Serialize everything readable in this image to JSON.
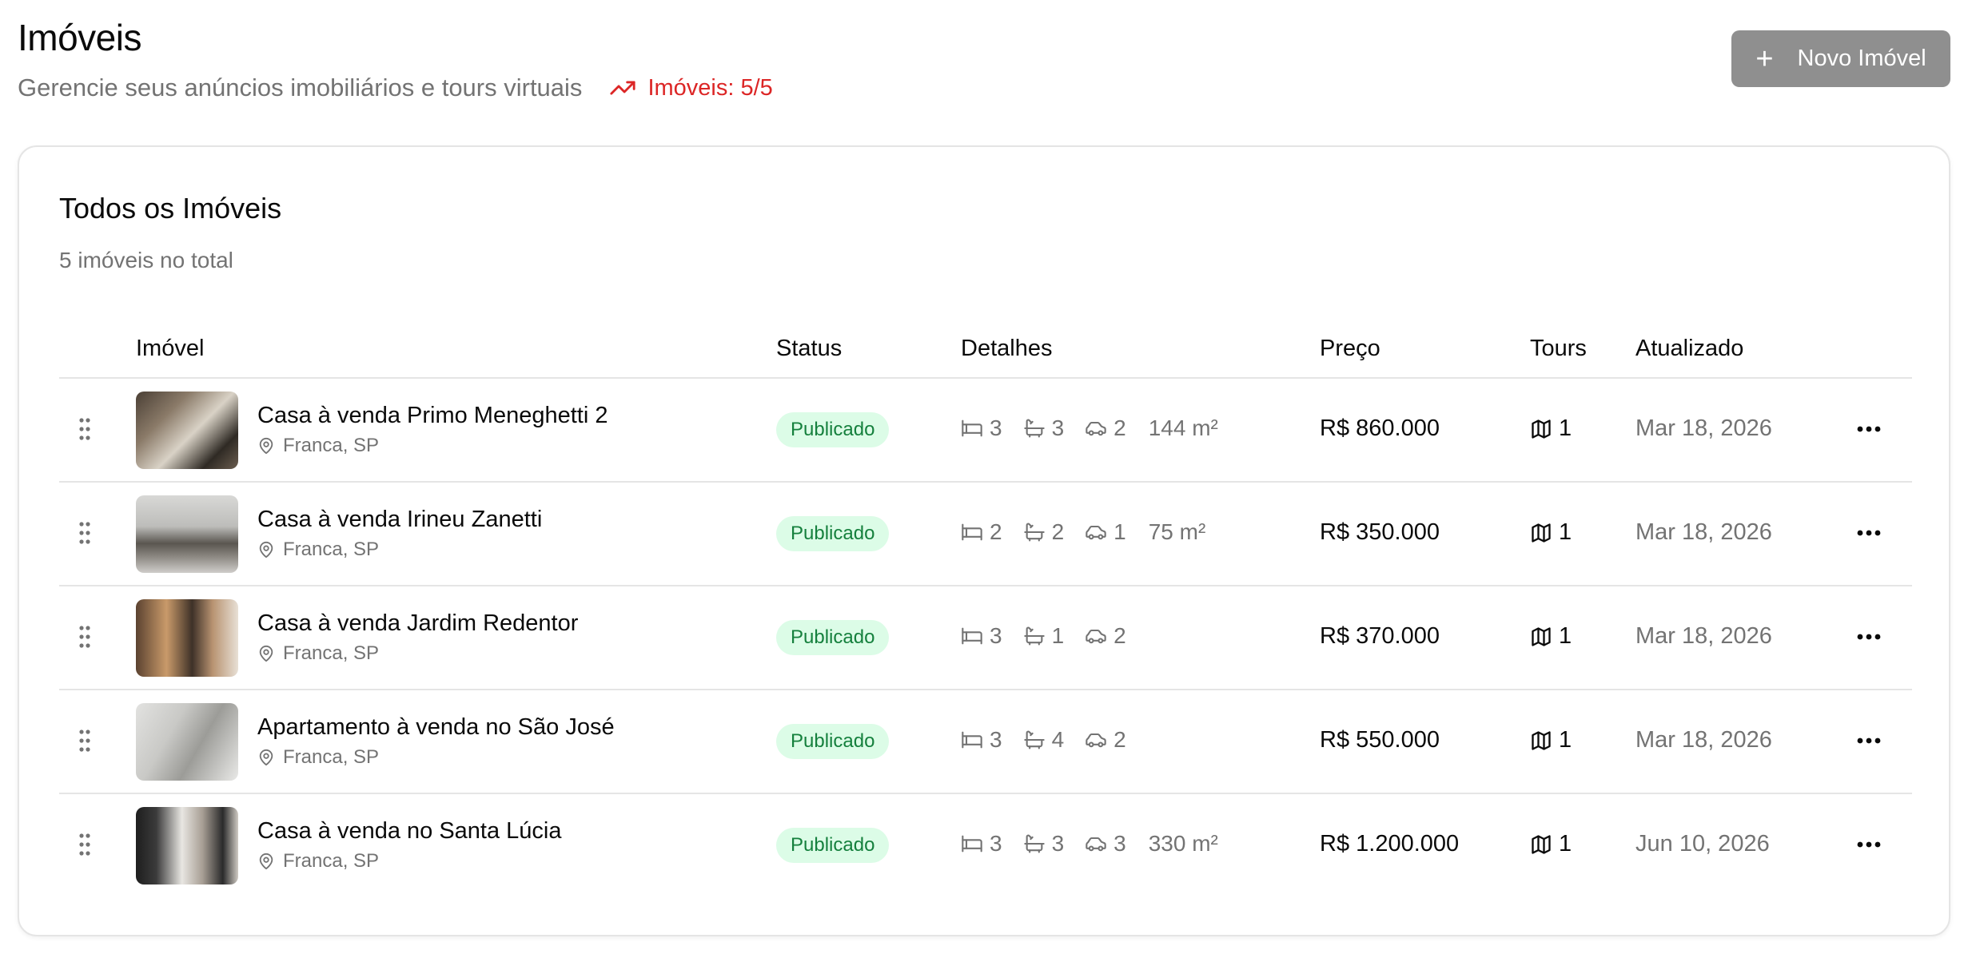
{
  "header": {
    "title": "Imóveis",
    "subtitle": "Gerencie seus anúncios imobiliários e tours virtuais",
    "usage": "Imóveis: 5/5",
    "new_button": "Novo Imóvel",
    "accent_color": "#dc2626"
  },
  "card": {
    "title": "Todos os Imóveis",
    "description": "5 imóveis no total"
  },
  "table": {
    "columns": [
      "Imóvel",
      "Status",
      "Detalhes",
      "Preço",
      "Tours",
      "Atualizado"
    ],
    "rows": [
      {
        "name": "Casa à venda Primo Meneghetti 2",
        "location": "Franca, SP",
        "status": "Publicado",
        "beds": "3",
        "baths": "3",
        "cars": "2",
        "area": "144 m²",
        "price": "R$ 860.000",
        "tours": "1",
        "updated": "Mar 18, 2026"
      },
      {
        "name": "Casa à venda Irineu Zanetti",
        "location": "Franca, SP",
        "status": "Publicado",
        "beds": "2",
        "baths": "2",
        "cars": "1",
        "area": "75 m²",
        "price": "R$ 350.000",
        "tours": "1",
        "updated": "Mar 18, 2026"
      },
      {
        "name": "Casa à venda Jardim Redentor",
        "location": "Franca, SP",
        "status": "Publicado",
        "beds": "3",
        "baths": "1",
        "cars": "2",
        "area": "",
        "price": "R$ 370.000",
        "tours": "1",
        "updated": "Mar 18, 2026"
      },
      {
        "name": "Apartamento à venda no São José",
        "location": "Franca, SP",
        "status": "Publicado",
        "beds": "3",
        "baths": "4",
        "cars": "2",
        "area": "",
        "price": "R$ 550.000",
        "tours": "1",
        "updated": "Mar 18, 2026"
      },
      {
        "name": "Casa à venda no Santa Lúcia",
        "location": "Franca, SP",
        "status": "Publicado",
        "beds": "3",
        "baths": "3",
        "cars": "3",
        "area": "330 m²",
        "price": "R$ 1.200.000",
        "tours": "1",
        "updated": "Jun 10, 2026"
      }
    ]
  }
}
